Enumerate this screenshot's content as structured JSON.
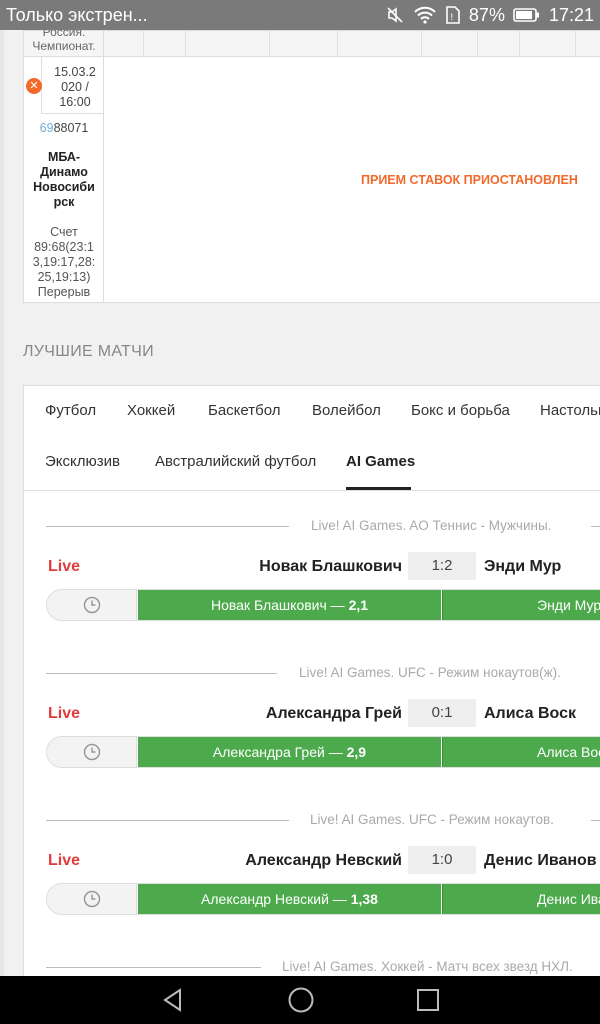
{
  "status_bar": {
    "notification": "Только экстрен...",
    "battery": "87%",
    "time": "17:21"
  },
  "table": {
    "header_text": "Россия.\nЧемпионат.",
    "date": "15.03.2\n020 /\n16:00",
    "match_id_highlight": "69",
    "match_id_rest": "88071",
    "team": "МБА-\nДинамо\nНовосиби\nрск",
    "score": "Счет\n89:68(23:1\n3,19:17,28:\n25,19:13)\nПерерыв",
    "suspended": "ПРИЕМ СТАВОК ПРИОСТАНОВЛЕН"
  },
  "best_matches": {
    "title": "ЛУЧШИЕ МАТЧИ",
    "tabs_row1": [
      "Футбол",
      "Хоккей",
      "Баскетбол",
      "Волейбол",
      "Бокс и борьба",
      "Настольный"
    ],
    "tabs_row2": [
      "Эксклюзив",
      "Австралийский футбол",
      "AI Games"
    ],
    "active_tab": "AI Games",
    "matches": [
      {
        "league": "Live! AI Games. AO Теннис - Мужчины.",
        "live": "Live",
        "home": "Новак Блашкович",
        "score": "1:2",
        "away": "Энди Мур",
        "odd_home_label": "Новак Блашкович — ",
        "odd_home_value": "2,1",
        "odd_away_label": "Энди Мур"
      },
      {
        "league": "Live! AI Games. UFC - Режим нокаутов(ж).",
        "live": "Live",
        "home": "Александра Грей",
        "score": "0:1",
        "away": "Алиса Воск",
        "odd_home_label": "Александра Грей — ",
        "odd_home_value": "2,9",
        "odd_away_label": "Алиса Воск"
      },
      {
        "league": "Live! AI Games. UFC - Режим нокаутов.",
        "live": "Live",
        "home": "Александр Невский",
        "score": "1:0",
        "away": "Денис Иванов",
        "odd_home_label": "Александр Невский — ",
        "odd_home_value": "1,38",
        "odd_away_label": "Денис Иванов"
      },
      {
        "league": "Live! AI Games. Хоккей - Матч всех звезд НХЛ."
      }
    ]
  },
  "colors": {
    "live": "#e23b3b",
    "odds_green": "#4caa4c",
    "suspended_orange": "#f26a2b"
  }
}
